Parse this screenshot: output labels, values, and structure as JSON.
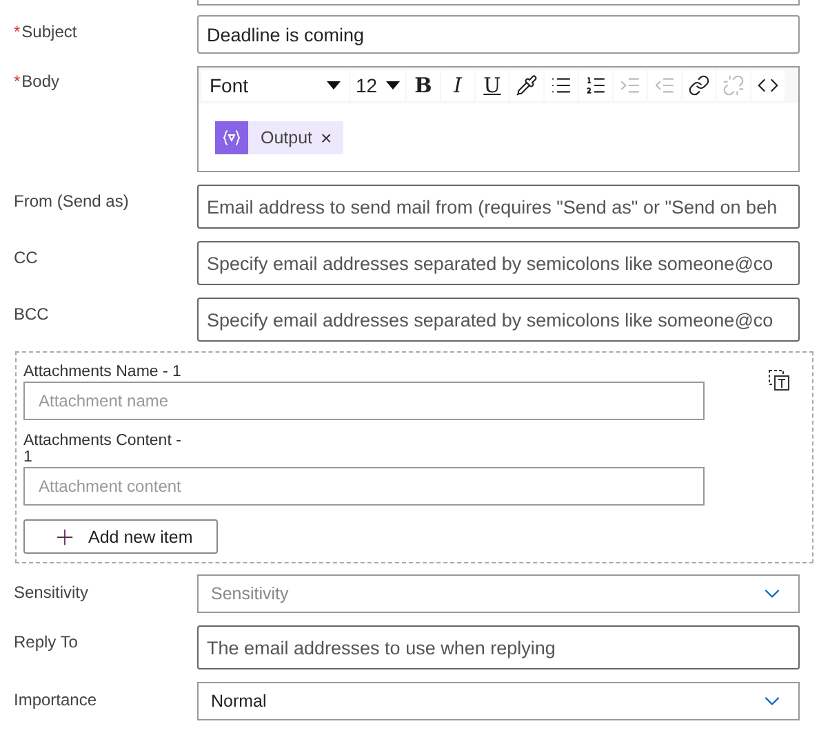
{
  "top_fields": [
    {
      "kind": "text",
      "label": "Subject",
      "required_mark": "*",
      "value": "Deadline is coming"
    },
    {
      "kind": "editor",
      "label": "Body",
      "required_mark": "*",
      "font": "Font",
      "size": "12",
      "toolbar": [
        {
          "kind": "bold",
          "glyph": "B",
          "disabled": false
        },
        {
          "kind": "italic",
          "glyph": "I",
          "disabled": false
        },
        {
          "kind": "underline",
          "glyph": "U",
          "disabled": false
        },
        {
          "kind": "color",
          "disabled": false
        },
        {
          "kind": "bullets",
          "disabled": false
        },
        {
          "kind": "numbers",
          "disabled": false
        },
        {
          "kind": "indent",
          "disabled": true
        },
        {
          "kind": "outdent",
          "disabled": true
        },
        {
          "kind": "link",
          "disabled": false
        },
        {
          "kind": "unlink",
          "disabled": true
        },
        {
          "kind": "code",
          "disabled": false
        }
      ],
      "tokens": [
        {
          "label": "Output",
          "remove": "×"
        }
      ]
    },
    {
      "kind": "text",
      "label": "From (Send as)",
      "placeholder": "Email address to send mail from (requires \"Send as\" or \"Send on beh"
    },
    {
      "kind": "text",
      "label": "CC",
      "placeholder": "Specify email addresses separated by semicolons like someone@co"
    },
    {
      "kind": "text",
      "label": "BCC",
      "placeholder": "Specify email addresses separated by semicolons like someone@co"
    }
  ],
  "attachments": {
    "items": [
      {
        "label": "Attachments Name - 1",
        "placeholder": "Attachment name"
      },
      {
        "label": "Attachments Content - 1",
        "placeholder": "Attachment content"
      }
    ],
    "add_button": "Add new item"
  },
  "bottom_fields": [
    {
      "kind": "select",
      "label": "Sensitivity",
      "placeholder": "Sensitivity"
    },
    {
      "kind": "text",
      "label": "Reply To",
      "placeholder": "The email addresses to use when replying"
    },
    {
      "kind": "select",
      "label": "Importance",
      "value": "Normal"
    }
  ]
}
